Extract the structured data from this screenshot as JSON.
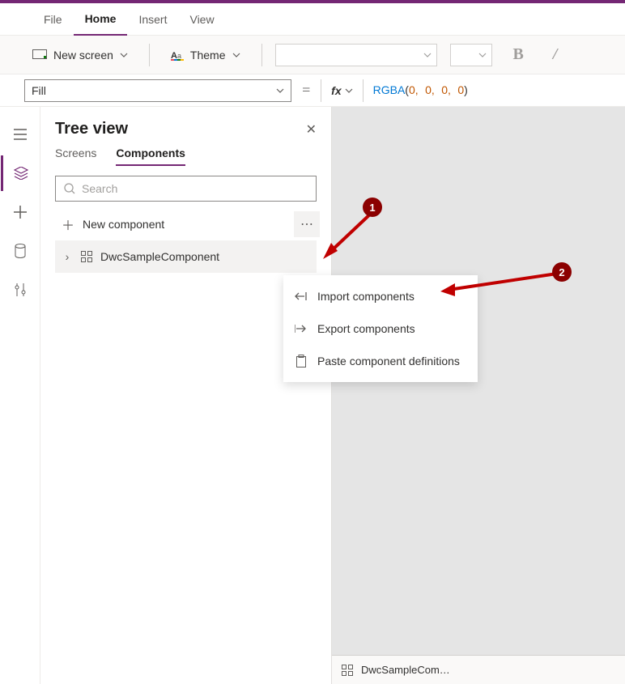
{
  "menu": {
    "file": "File",
    "home": "Home",
    "insert": "Insert",
    "view": "View"
  },
  "toolbar": {
    "new_screen": "New screen",
    "theme": "Theme",
    "bold_letter": "B",
    "slash": "/"
  },
  "formula": {
    "property": "Fill",
    "eq": "=",
    "fx": "fx",
    "fn": "RGBA",
    "open": "(",
    "v1": "0",
    "c": ",",
    "v2": "0",
    "v3": "0",
    "v4": "0",
    "close": ")"
  },
  "panel": {
    "title": "Tree view",
    "tab_screens": "Screens",
    "tab_components": "Components",
    "search_placeholder": "Search",
    "new_component": "New component",
    "component_name": "DwcSampleComponent"
  },
  "context": {
    "import": "Import components",
    "export": "Export components",
    "paste": "Paste component definitions"
  },
  "status": {
    "component": "DwcSampleCom…"
  },
  "annotations": {
    "b1": "1",
    "b2": "2"
  }
}
